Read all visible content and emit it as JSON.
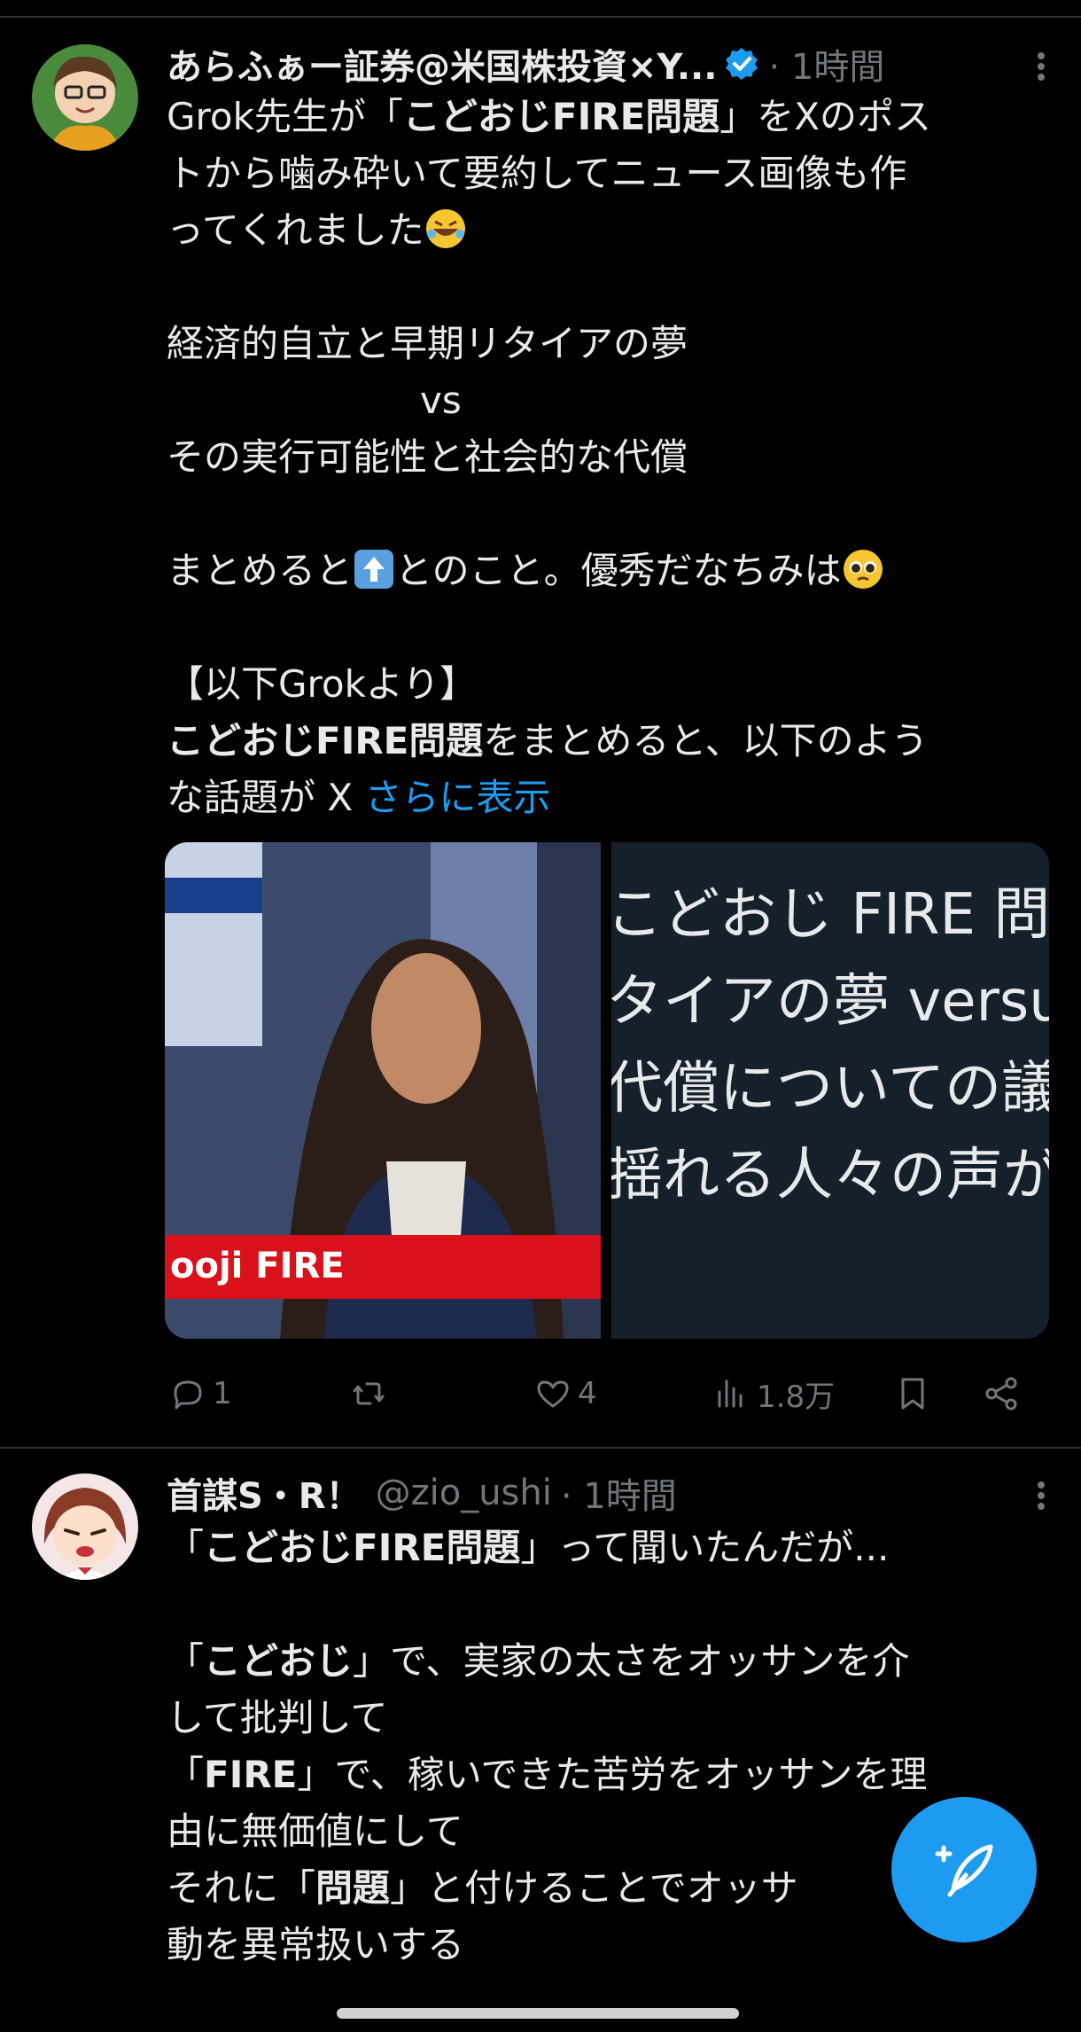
{
  "tweets": [
    {
      "author_name": "あらふぁー証券@米国株投資×Y...",
      "verified": true,
      "time": "· 1時間",
      "lines": [
        {
          "t": "Grok先生が「"
        },
        {
          "t": "こどおじFIRE問題"
        },
        {
          "t": "」をXのポス"
        },
        {
          "t": "トから噛み砕いて要約してニュース画像も作"
        },
        {
          "t": "ってくれました"
        },
        {
          "t": "経済的自立と早期リタイアの夢"
        },
        {
          "t": "vs"
        },
        {
          "t": "その実行可能性と社会的な代償"
        },
        {
          "t": "まとめると"
        },
        {
          "t": "とのこと。優秀だなちみは"
        },
        {
          "t": "【以下Grokより】"
        },
        {
          "t": "こどおじFIRE問題"
        },
        {
          "t": "をまとめると、以下のよう"
        },
        {
          "t": "な話題が X "
        },
        {
          "t": "さらに表示"
        }
      ],
      "media": {
        "news_banner": "ooji FIRE",
        "text_card_lines": [
          "こどおじ FIRE 問",
          "タイアの夢 versu",
          "代償についての議",
          "揺れる人々の声が"
        ]
      },
      "actions": {
        "replies": "1",
        "retweets": "",
        "likes": "4",
        "views": "1.8万"
      }
    },
    {
      "author_name": "首謀S・R！",
      "handle": "@zio_ushi",
      "time": "· 1時間",
      "lines": [
        {
          "t": "「"
        },
        {
          "t": "こどおじFIRE問題"
        },
        {
          "t": "」って聞いたんだが..."
        },
        {
          "t": "「"
        },
        {
          "t": "こどおじ"
        },
        {
          "t": "」で、実家の太さをオッサンを介"
        },
        {
          "t": "して批判して"
        },
        {
          "t": "「"
        },
        {
          "t": "FIRE"
        },
        {
          "t": "」で、稼いできた苦労をオッサンを理"
        },
        {
          "t": "由に無価値にして"
        },
        {
          "t": "それに「"
        },
        {
          "t": "問題"
        },
        {
          "t": "」と付けることでオッサ"
        },
        {
          "t": "動を異常扱いする"
        }
      ]
    }
  ],
  "colors": {
    "background": "#000000",
    "text": "#e7e9ea",
    "muted": "#71767b",
    "accent": "#1d9bf0",
    "divider": "#2f3336"
  },
  "icons": [
    "verified-badge-icon",
    "more-icon",
    "reply-icon",
    "retweet-icon",
    "like-icon",
    "views-icon",
    "bookmark-icon",
    "share-icon",
    "compose-icon"
  ]
}
